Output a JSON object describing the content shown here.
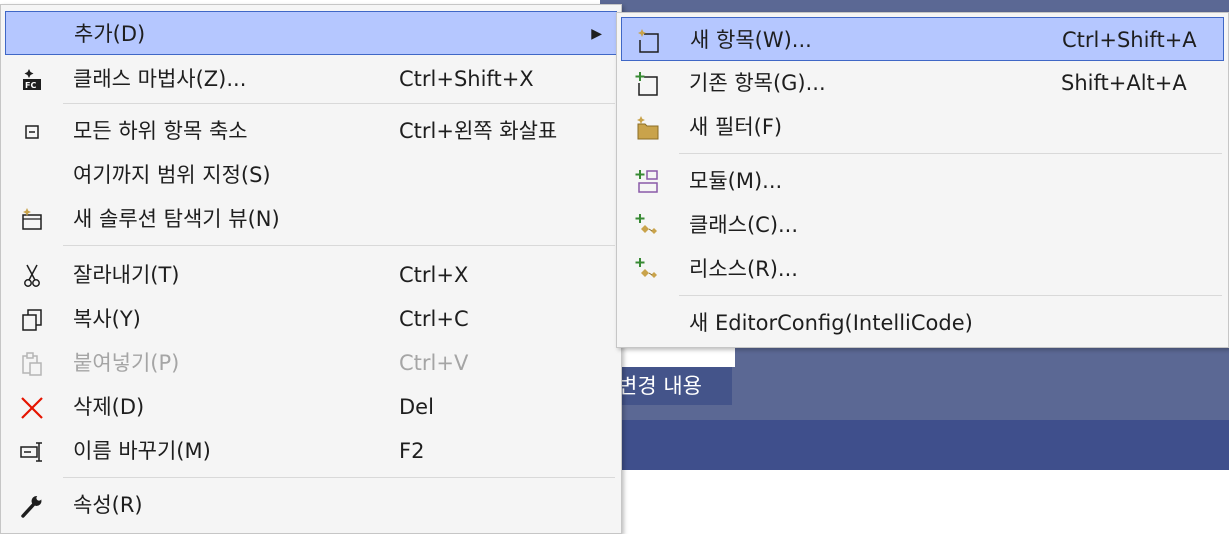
{
  "background": {
    "label": "변경 내용"
  },
  "main_menu": {
    "items": [
      {
        "label": "추가(D)",
        "shortcut": "",
        "icon": "none",
        "submenu": true
      },
      {
        "label": "클래스 마법사(Z)...",
        "shortcut": "Ctrl+Shift+X",
        "icon": "class-wizard-icon"
      },
      {
        "label": "모든 하위 항목 축소",
        "shortcut": "Ctrl+왼쪽 화살표",
        "icon": "collapse-all-icon"
      },
      {
        "label": "여기까지 범위 지정(S)",
        "shortcut": "",
        "icon": "none"
      },
      {
        "label": "새 솔루션 탐색기 뷰(N)",
        "shortcut": "",
        "icon": "new-solution-view-icon"
      },
      {
        "label": "잘라내기(T)",
        "shortcut": "Ctrl+X",
        "icon": "scissors-icon"
      },
      {
        "label": "복사(Y)",
        "shortcut": "Ctrl+C",
        "icon": "copy-icon"
      },
      {
        "label": "붙여넣기(P)",
        "shortcut": "Ctrl+V",
        "icon": "paste-icon",
        "disabled": true
      },
      {
        "label": "삭제(D)",
        "shortcut": "Del",
        "icon": "delete-icon"
      },
      {
        "label": "이름 바꾸기(M)",
        "shortcut": "F2",
        "icon": "rename-icon"
      },
      {
        "label": "속성(R)",
        "shortcut": "",
        "icon": "wrench-icon"
      }
    ]
  },
  "sub_menu": {
    "items": [
      {
        "label": "새 항목(W)...",
        "shortcut": "Ctrl+Shift+A",
        "icon": "new-item-icon"
      },
      {
        "label": "기존 항목(G)...",
        "shortcut": "Shift+Alt+A",
        "icon": "existing-item-icon"
      },
      {
        "label": "새 필터(F)",
        "shortcut": "",
        "icon": "new-filter-icon"
      },
      {
        "label": "모듈(M)...",
        "shortcut": "",
        "icon": "module-icon"
      },
      {
        "label": "클래스(C)...",
        "shortcut": "",
        "icon": "add-class-icon"
      },
      {
        "label": "리소스(R)...",
        "shortcut": "",
        "icon": "add-resource-icon"
      },
      {
        "label": "새 EditorConfig(IntelliCode)",
        "shortcut": "",
        "icon": "none"
      }
    ]
  },
  "colors": {
    "highlight": "#b5c7ff",
    "highlight_border": "#3f67c6",
    "menu_bg": "#f5f5f5",
    "delete_red": "#e51400",
    "add_green": "#388a34",
    "folder_gold": "#c9a34b"
  }
}
